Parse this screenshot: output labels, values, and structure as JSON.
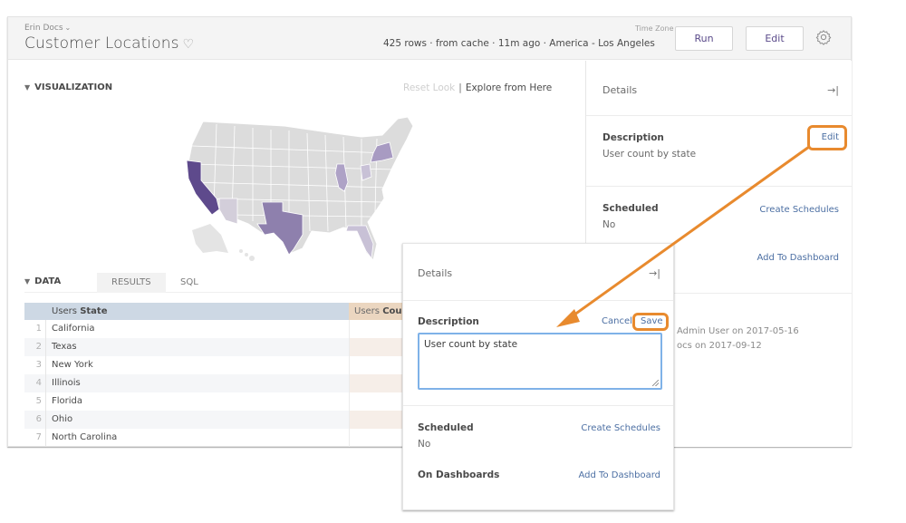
{
  "header": {
    "folder": "Erin Docs",
    "title": "Customer Locations",
    "meta": "425 rows · from cache · 11m ago · America - Los Angeles",
    "timezone_label": "Time Zone",
    "run_label": "Run",
    "edit_label": "Edit"
  },
  "visualization": {
    "section_label": "VISUALIZATION",
    "reset_look": "Reset Look",
    "separator": "|",
    "explore": "Explore from Here",
    "map_colors": {
      "base": "#dcdcdc",
      "california": "#5e4a8c",
      "texas": "#8e80ad",
      "new_york": "#a89bc2",
      "illinois": "#aea2c6",
      "mid": "#c8c1d6",
      "light": "#d3ceda"
    }
  },
  "data": {
    "section_label": "DATA",
    "tabs": [
      "RESULTS",
      "SQL"
    ],
    "columns": [
      {
        "prefix": "Users",
        "name": "State"
      },
      {
        "prefix": "Users",
        "name": "Coun"
      }
    ],
    "rows": [
      {
        "index": "1",
        "state": "California"
      },
      {
        "index": "2",
        "state": "Texas"
      },
      {
        "index": "3",
        "state": "New York"
      },
      {
        "index": "4",
        "state": "Illinois"
      },
      {
        "index": "5",
        "state": "Florida"
      },
      {
        "index": "6",
        "state": "Ohio"
      },
      {
        "index": "7",
        "state": "North Carolina"
      }
    ]
  },
  "details": {
    "title": "Details",
    "collapse_icon": "→|",
    "description_label": "Description",
    "description_value": "User count by state",
    "edit_link": "Edit",
    "scheduled_label": "Scheduled",
    "scheduled_value": "No",
    "create_schedules": "Create Schedules",
    "add_to_dashboard": "Add To Dashboard",
    "history": [
      "Admin User on 2017-05-16",
      "ocs on 2017-09-12"
    ]
  },
  "popup": {
    "title": "Details",
    "collapse_icon": "→|",
    "description_label": "Description",
    "cancel": "Cancel",
    "save": "Save",
    "textarea_value": "User count by state",
    "scheduled_label": "Scheduled",
    "scheduled_value": "No",
    "create_schedules": "Create Schedules",
    "dashboards_label": "On Dashboards",
    "add_to_dashboard": "Add To Dashboard"
  },
  "annotation": {
    "color": "#e88a2e"
  }
}
